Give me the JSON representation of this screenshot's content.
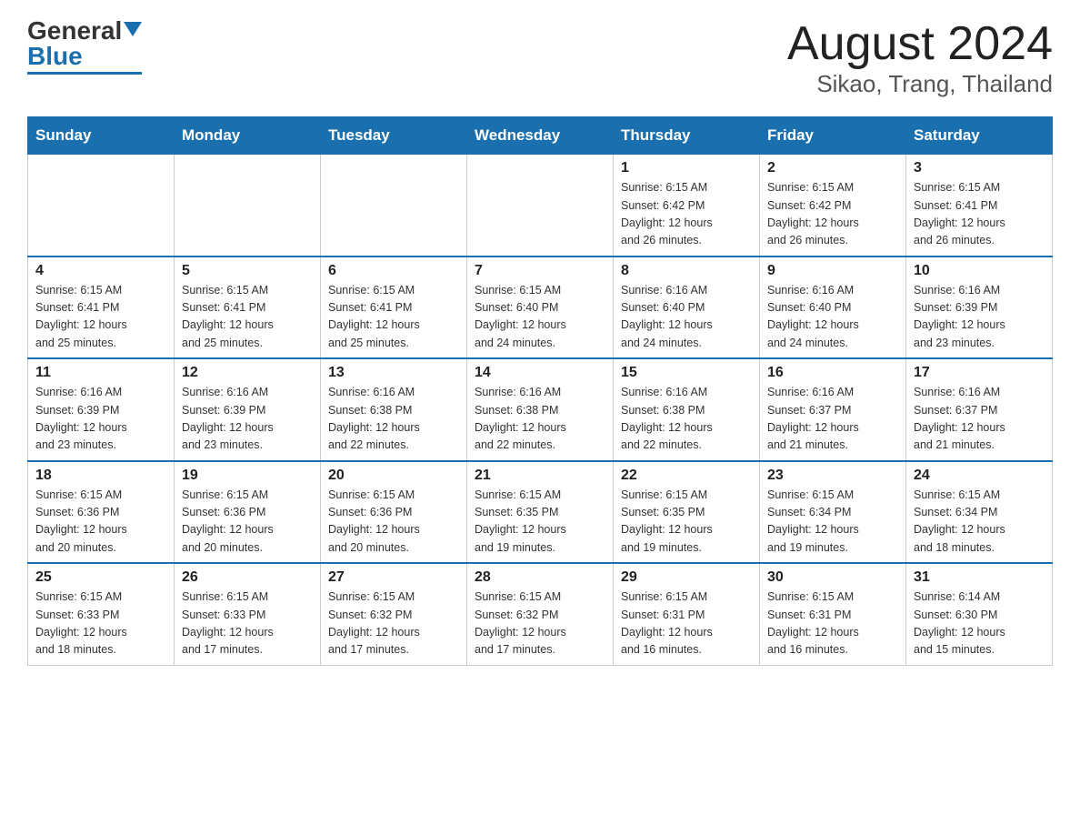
{
  "logo": {
    "general": "General",
    "blue": "Blue"
  },
  "title": "August 2024",
  "subtitle": "Sikao, Trang, Thailand",
  "days_of_week": [
    "Sunday",
    "Monday",
    "Tuesday",
    "Wednesday",
    "Thursday",
    "Friday",
    "Saturday"
  ],
  "weeks": [
    [
      {
        "day": "",
        "info": ""
      },
      {
        "day": "",
        "info": ""
      },
      {
        "day": "",
        "info": ""
      },
      {
        "day": "",
        "info": ""
      },
      {
        "day": "1",
        "info": "Sunrise: 6:15 AM\nSunset: 6:42 PM\nDaylight: 12 hours\nand 26 minutes."
      },
      {
        "day": "2",
        "info": "Sunrise: 6:15 AM\nSunset: 6:42 PM\nDaylight: 12 hours\nand 26 minutes."
      },
      {
        "day": "3",
        "info": "Sunrise: 6:15 AM\nSunset: 6:41 PM\nDaylight: 12 hours\nand 26 minutes."
      }
    ],
    [
      {
        "day": "4",
        "info": "Sunrise: 6:15 AM\nSunset: 6:41 PM\nDaylight: 12 hours\nand 25 minutes."
      },
      {
        "day": "5",
        "info": "Sunrise: 6:15 AM\nSunset: 6:41 PM\nDaylight: 12 hours\nand 25 minutes."
      },
      {
        "day": "6",
        "info": "Sunrise: 6:15 AM\nSunset: 6:41 PM\nDaylight: 12 hours\nand 25 minutes."
      },
      {
        "day": "7",
        "info": "Sunrise: 6:15 AM\nSunset: 6:40 PM\nDaylight: 12 hours\nand 24 minutes."
      },
      {
        "day": "8",
        "info": "Sunrise: 6:16 AM\nSunset: 6:40 PM\nDaylight: 12 hours\nand 24 minutes."
      },
      {
        "day": "9",
        "info": "Sunrise: 6:16 AM\nSunset: 6:40 PM\nDaylight: 12 hours\nand 24 minutes."
      },
      {
        "day": "10",
        "info": "Sunrise: 6:16 AM\nSunset: 6:39 PM\nDaylight: 12 hours\nand 23 minutes."
      }
    ],
    [
      {
        "day": "11",
        "info": "Sunrise: 6:16 AM\nSunset: 6:39 PM\nDaylight: 12 hours\nand 23 minutes."
      },
      {
        "day": "12",
        "info": "Sunrise: 6:16 AM\nSunset: 6:39 PM\nDaylight: 12 hours\nand 23 minutes."
      },
      {
        "day": "13",
        "info": "Sunrise: 6:16 AM\nSunset: 6:38 PM\nDaylight: 12 hours\nand 22 minutes."
      },
      {
        "day": "14",
        "info": "Sunrise: 6:16 AM\nSunset: 6:38 PM\nDaylight: 12 hours\nand 22 minutes."
      },
      {
        "day": "15",
        "info": "Sunrise: 6:16 AM\nSunset: 6:38 PM\nDaylight: 12 hours\nand 22 minutes."
      },
      {
        "day": "16",
        "info": "Sunrise: 6:16 AM\nSunset: 6:37 PM\nDaylight: 12 hours\nand 21 minutes."
      },
      {
        "day": "17",
        "info": "Sunrise: 6:16 AM\nSunset: 6:37 PM\nDaylight: 12 hours\nand 21 minutes."
      }
    ],
    [
      {
        "day": "18",
        "info": "Sunrise: 6:15 AM\nSunset: 6:36 PM\nDaylight: 12 hours\nand 20 minutes."
      },
      {
        "day": "19",
        "info": "Sunrise: 6:15 AM\nSunset: 6:36 PM\nDaylight: 12 hours\nand 20 minutes."
      },
      {
        "day": "20",
        "info": "Sunrise: 6:15 AM\nSunset: 6:36 PM\nDaylight: 12 hours\nand 20 minutes."
      },
      {
        "day": "21",
        "info": "Sunrise: 6:15 AM\nSunset: 6:35 PM\nDaylight: 12 hours\nand 19 minutes."
      },
      {
        "day": "22",
        "info": "Sunrise: 6:15 AM\nSunset: 6:35 PM\nDaylight: 12 hours\nand 19 minutes."
      },
      {
        "day": "23",
        "info": "Sunrise: 6:15 AM\nSunset: 6:34 PM\nDaylight: 12 hours\nand 19 minutes."
      },
      {
        "day": "24",
        "info": "Sunrise: 6:15 AM\nSunset: 6:34 PM\nDaylight: 12 hours\nand 18 minutes."
      }
    ],
    [
      {
        "day": "25",
        "info": "Sunrise: 6:15 AM\nSunset: 6:33 PM\nDaylight: 12 hours\nand 18 minutes."
      },
      {
        "day": "26",
        "info": "Sunrise: 6:15 AM\nSunset: 6:33 PM\nDaylight: 12 hours\nand 17 minutes."
      },
      {
        "day": "27",
        "info": "Sunrise: 6:15 AM\nSunset: 6:32 PM\nDaylight: 12 hours\nand 17 minutes."
      },
      {
        "day": "28",
        "info": "Sunrise: 6:15 AM\nSunset: 6:32 PM\nDaylight: 12 hours\nand 17 minutes."
      },
      {
        "day": "29",
        "info": "Sunrise: 6:15 AM\nSunset: 6:31 PM\nDaylight: 12 hours\nand 16 minutes."
      },
      {
        "day": "30",
        "info": "Sunrise: 6:15 AM\nSunset: 6:31 PM\nDaylight: 12 hours\nand 16 minutes."
      },
      {
        "day": "31",
        "info": "Sunrise: 6:14 AM\nSunset: 6:30 PM\nDaylight: 12 hours\nand 15 minutes."
      }
    ]
  ]
}
